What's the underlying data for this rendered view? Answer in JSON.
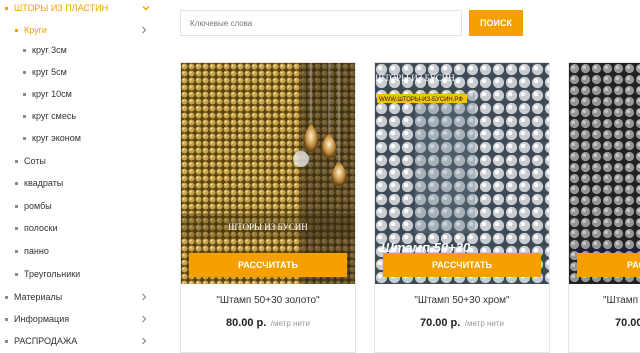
{
  "sidebar": {
    "top_category": "ШТОРЫ ИЗ ПЛАСТИН",
    "subcategory": "Круги",
    "circle_items": [
      "круг 3см",
      "круг 5см",
      "круг 10см",
      "круг смесь",
      "круг эконом"
    ],
    "other_items": [
      "Соты",
      "квадраты",
      "ромбы",
      "полоски",
      "панно",
      "Треугольники"
    ],
    "sections": [
      "Материалы",
      "Информация",
      "РАСПРОДАЖА"
    ]
  },
  "search": {
    "placeholder": "Ключевые слова",
    "button_label": "ПОИСК"
  },
  "products": [
    {
      "title": "\"Штамп 50+30 золото\"",
      "price": "80.00 р.",
      "unit": "/метр нити",
      "button": "РАССЧИТАТЬ",
      "watermark": "ШТОРЫ ИЗ БУСИН"
    },
    {
      "title": "\"Штамп 50+30 хром\"",
      "price": "70.00 р.",
      "unit": "/метр нити",
      "button": "РАССЧИТАТЬ",
      "watermark": "ШТОРЫ ИЗ БУСИН",
      "site": "WWW.ШТОРЫ-ИЗ-БУСИН.РФ",
      "overlay": "Штамп 50+30"
    },
    {
      "title": "\"Штамп 50",
      "price": "70.00",
      "unit": "",
      "button": "РАСС"
    }
  ],
  "colors": {
    "accent": "#f5a000",
    "text": "#333333",
    "muted": "#999999",
    "border": "#e6e6e6"
  }
}
